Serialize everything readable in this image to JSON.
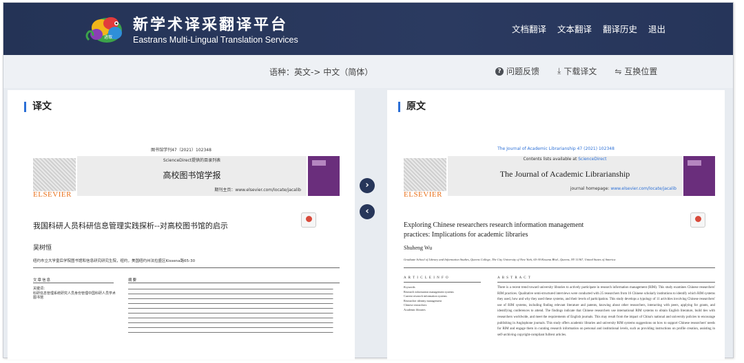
{
  "header": {
    "brand_cn": "新学术译采翻译平台",
    "brand_en": "Eastrans Multi-Lingual Translation Services",
    "logo_text": "进取",
    "nav": [
      "文档翻译",
      "文本翻译",
      "翻译历史",
      "退出"
    ]
  },
  "toolbar": {
    "language": "语种：英文-> 中文（简体）",
    "feedback": "问题反馈",
    "download": "下载译文",
    "swap": "互换位置"
  },
  "left_panel": {
    "title": "译文",
    "doc_top": "图书馆学刊47（2021）102348",
    "banner_head": "ScienceDirect提供的目录列表",
    "journal": "高校图书馆学报",
    "homepage": "期刊主页：www.elsevier.com/locate/jacalib",
    "publisher": "ELSEVIER",
    "article_title": "我国科研人员科研信息管理实践探析--对高校图书馆的启示",
    "author": "吴树恒",
    "affil": "纽约市立大学皇后学院图书馆和信息研究研究生院，纽约，美国纽约州法拉盛区Kissena路65-30",
    "info_head": "文章信息",
    "abstract_head": "摘要",
    "keywords_label": "关键词：",
    "keywords": "科研信息管理系统研究人员身份管理中国科研人员学术图书馆"
  },
  "right_panel": {
    "title": "原文",
    "doc_top": "The Journal of Academic Librarianship 47 (2021) 102348",
    "banner_head": "Contents lists available at ",
    "banner_link": "ScienceDirect",
    "journal": "The Journal of Academic Librarianship",
    "homepage_label": "journal homepage: ",
    "homepage_link": "www.elsevier.com/locate/jacalib",
    "publisher": "ELSEVIER",
    "article_title": "Exploring Chinese researchers research information management practices: Implications for academic libraries",
    "author": "Shuheng Wu",
    "affil": "Graduate School of Library and Information Studies, Queens College, The City University of New York, 65-30 Kissena Blvd., Queens, NY 11367, United States of America",
    "info_head": "A R T I C L E   I N F O",
    "abstract_head": "A B S T R A C T",
    "keywords": [
      "Keywords",
      "Research information management systems",
      "Current research information systems",
      "Researcher identity management",
      "Chinese researchers",
      "Academic libraries"
    ],
    "abstract": "There is a recent trend toward university libraries to actively participate in research information management (RIM). This study examines Chinese researchers' RIM practices. Qualitative semi-structured interviews were conducted with 25 researchers from 16 Chinese scholarly institutions to identify which RIM systems they used, how and why they used these systems, and their levels of participation. This study develops a typology of 11 activities involving Chinese researchers' use of RIM systems, including finding relevant literature and patents, knowing about other researchers, interacting with peers, applying for grants, and identifying conferences to attend. The findings indicate that Chinese researchers use international RIM systems to obtain English literature, build ties with researchers worldwide, and meet the requirements of English journals. This may result from the impact of China's national and university policies to encourage publishing in Anglophone journals. This study offers academic libraries and university RIM systems suggestions on how to support Chinese researchers' needs for RIM and engage them in curating research information on personal and institutional levels, such as providing instructions on profile creation, assisting in self-archiving copyright-compliant fulltext articles."
  },
  "colors": {
    "header_bg": "#27365a",
    "accent": "#2b6fd6",
    "toolbar_bg": "#eef1f5",
    "elsevier_orange": "#e9711c"
  },
  "icons": {
    "feedback": "question-circle-icon",
    "download": "download-icon",
    "swap": "swap-icon",
    "next": "chevron-right-icon",
    "prev": "chevron-left-icon"
  }
}
